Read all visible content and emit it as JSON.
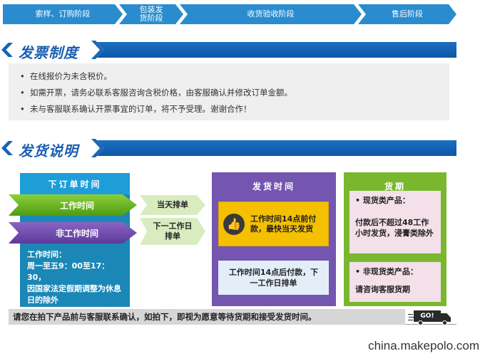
{
  "process_steps": [
    {
      "label": "索样、订购阶段"
    },
    {
      "label": "包装发货阶段"
    },
    {
      "label": "收货验收阶段"
    },
    {
      "label": "售后阶段"
    }
  ],
  "invoice": {
    "title": "发票制度",
    "items": [
      "在线报价为未含税价。",
      "如需开票，请务必联系客服咨询含税价格，由客服确认并修改订单金额。",
      "未与客服联系确认开票事宜的订单，将不予受理。谢谢合作！"
    ]
  },
  "shipping": {
    "title": "发货说明",
    "order_time_header": "下订单时间",
    "work_time_label": "工作时间",
    "non_work_time_label": "非工作时间",
    "work_hours": {
      "line1": "工作时间：",
      "line2": "周一至五9：00至17：30，",
      "line3": "因国家法定假期调整为休息日的除外"
    },
    "same_day": "当天排单",
    "next_day": "下一工作日排单",
    "ship_time_header": "发货时间",
    "before_14": "工作时间14点前付款，最快当天发货",
    "after_14": "工作时间14点后付款，下一工作日排单",
    "lead_time_header": "货期",
    "in_stock_title": "• 现货类产品：",
    "in_stock_text": "付款后不超过48工作小时发货，浸膏类除外",
    "non_stock_title": "• 非现货类产品：",
    "non_stock_text": "请咨询客服货期"
  },
  "notice": "请您在拍下产品前与客服联系确认，如拍下，即视为愿意等待货期和接受发货时间。",
  "truck_label": "GO!",
  "watermark": "china.makepolo.com",
  "colors": {
    "banner_blue": "#1565b3",
    "teal": "#1b87b6",
    "purple": "#7456b0",
    "green": "#79b82e",
    "yellow": "#f5c000"
  }
}
